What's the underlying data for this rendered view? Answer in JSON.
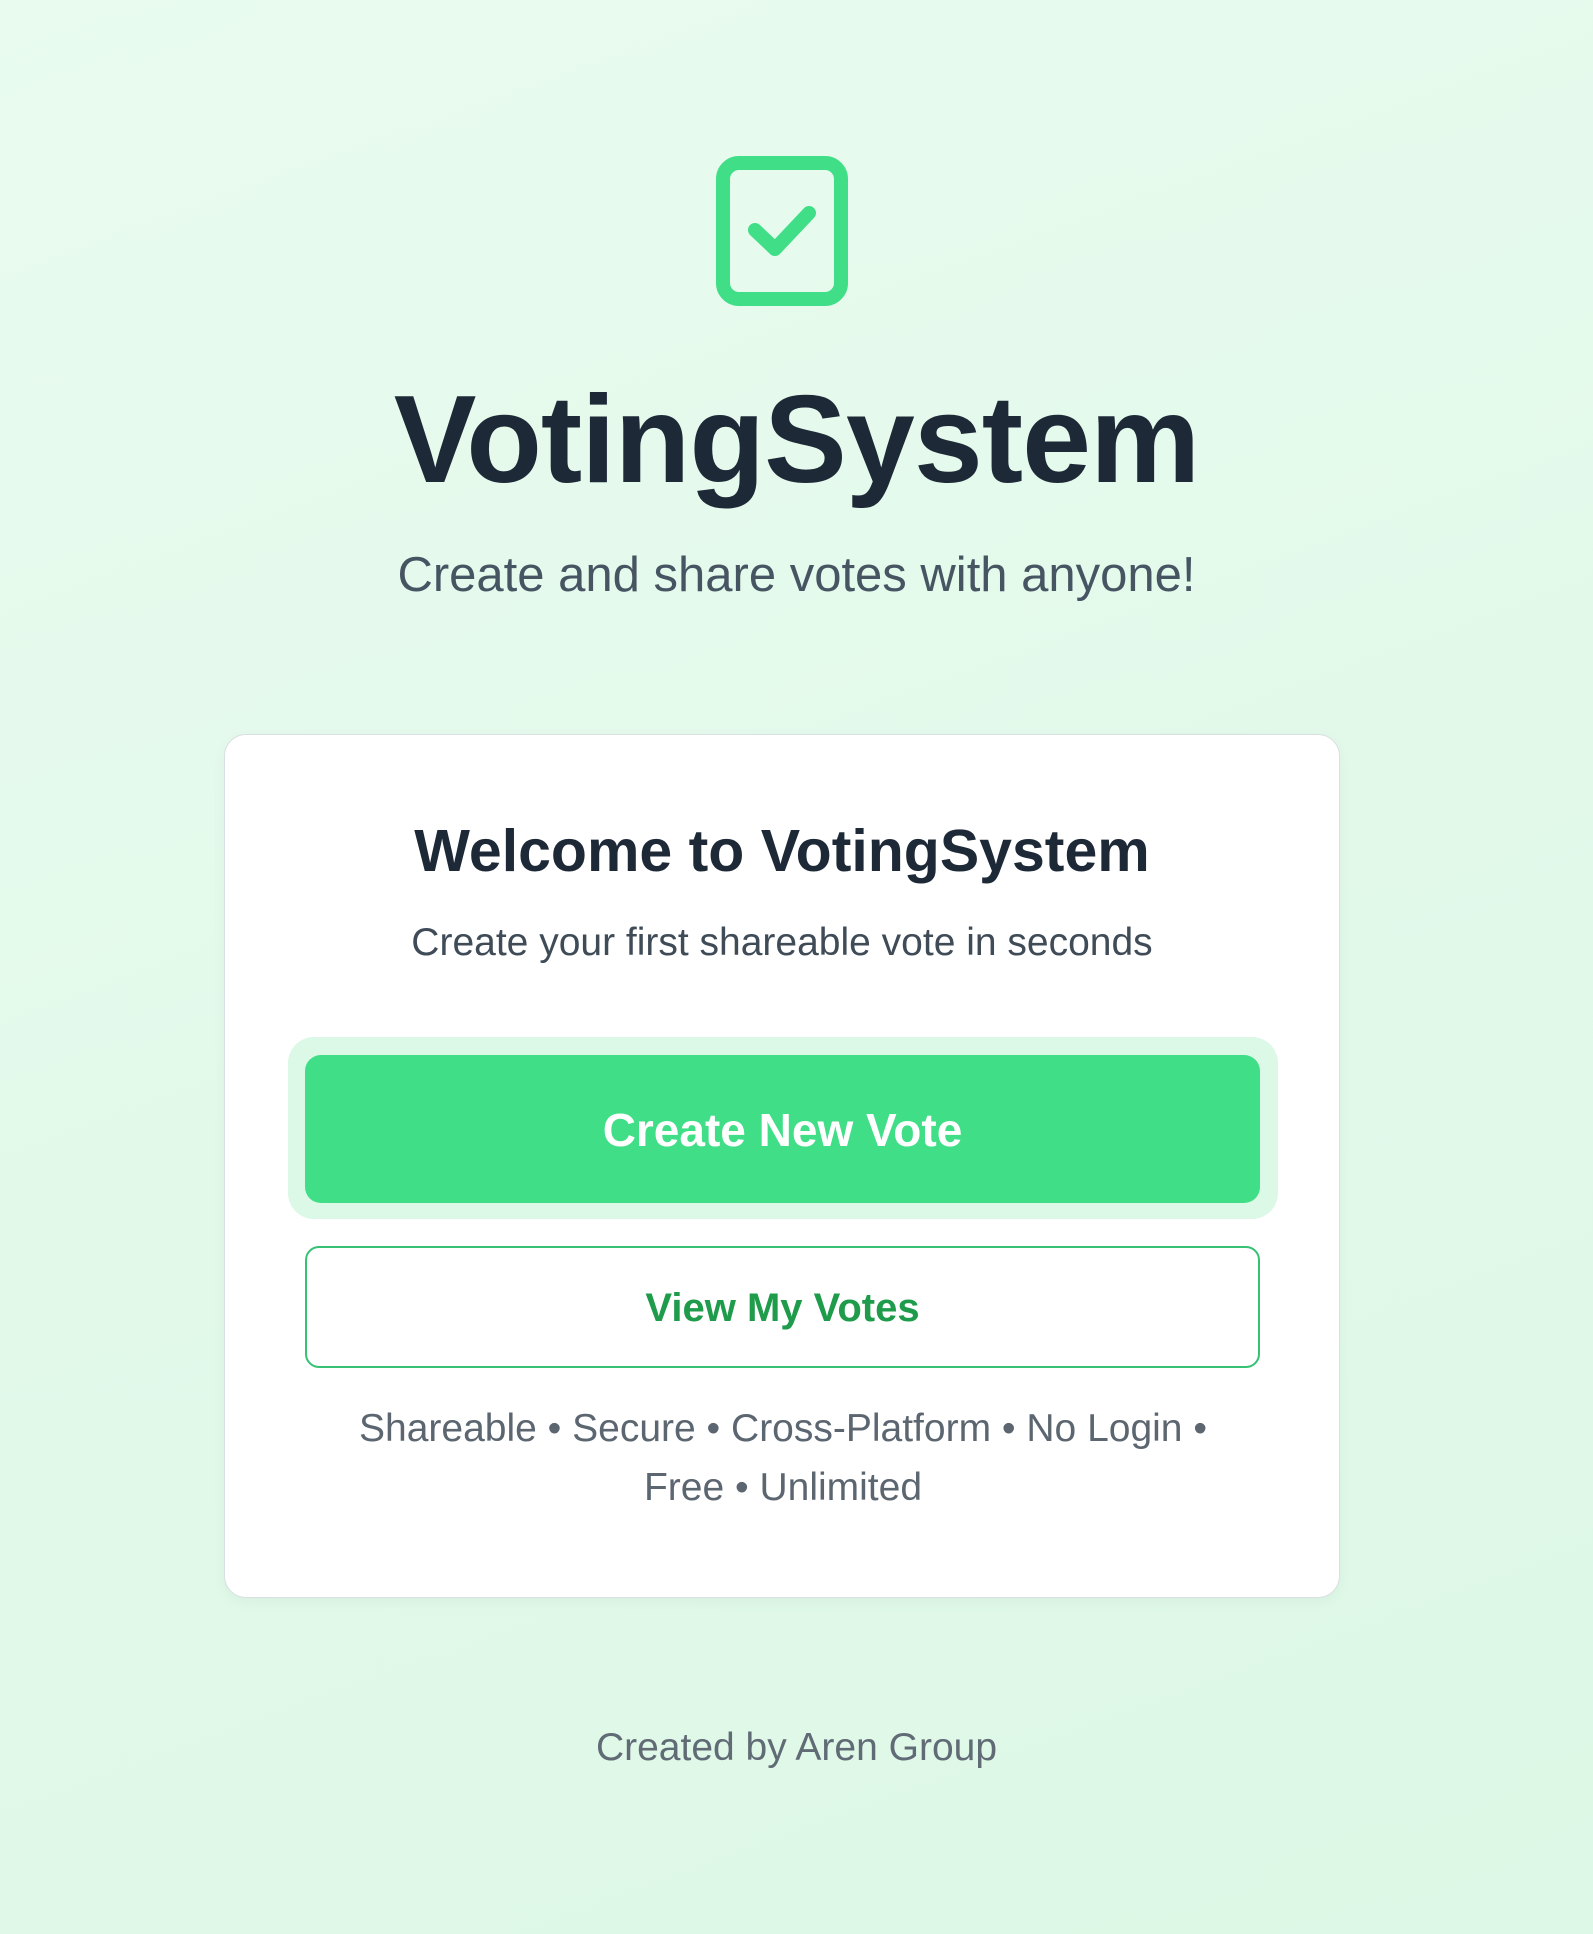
{
  "logo": {
    "icon": "check-square-icon",
    "color": "#40de87"
  },
  "header": {
    "title": "VotingSystem",
    "tagline": "Create and share votes with anyone!"
  },
  "card": {
    "title": "Welcome to VotingSystem",
    "subtitle": "Create your first shareable vote in seconds",
    "create_label": "Create New Vote",
    "view_label": "View My Votes",
    "features_line1": "Shareable • Secure • Cross-Platform • No Login •",
    "features_line2": "Free • Unlimited"
  },
  "footer": {
    "credit": "Created by Aren Group"
  },
  "colors": {
    "accent": "#40de87",
    "accent_dark": "#1f9b4c",
    "text_dark": "#1e2937",
    "background": "#e5faec"
  }
}
